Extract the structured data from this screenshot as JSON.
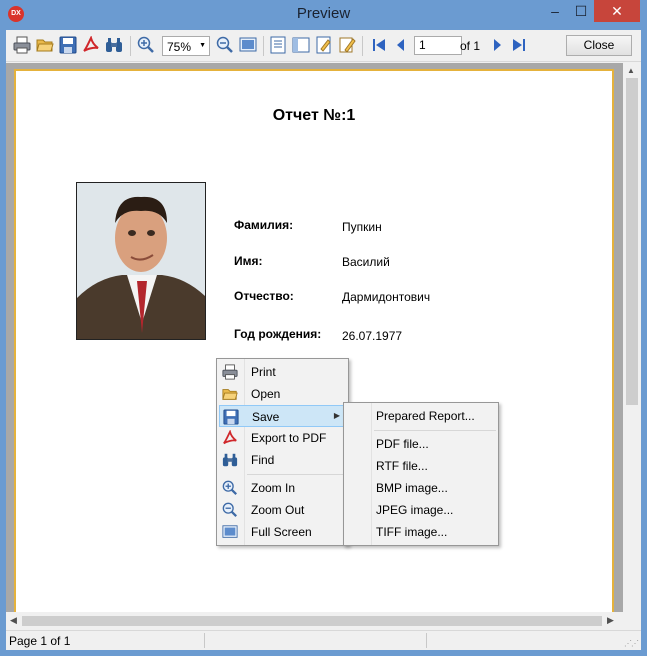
{
  "window": {
    "title": "Preview",
    "app_icon_text": "DX",
    "minimize": "–",
    "maximize": "☐",
    "close": "✕"
  },
  "toolbar": {
    "zoom": "75%",
    "page_current": "1",
    "page_total_text": "of 1",
    "close_label": "Close"
  },
  "report": {
    "title": "Отчет №:1",
    "fields": [
      {
        "label": "Фамилия:",
        "value": "Пупкин"
      },
      {
        "label": "Имя:",
        "value": "Василий"
      },
      {
        "label": "Отчество:",
        "value": "Дармидонтович"
      },
      {
        "label": "Год рождения:",
        "value": "26.07.1977"
      }
    ]
  },
  "context_menu": {
    "items": [
      "Print",
      "Open",
      "Save",
      "Export to PDF",
      "Find",
      "Zoom In",
      "Zoom Out",
      "Full Screen"
    ],
    "highlighted": "Save"
  },
  "save_submenu": {
    "items": [
      "Prepared Report...",
      "PDF file...",
      "RTF file...",
      "BMP image...",
      "JPEG image...",
      "TIFF image..."
    ]
  },
  "statusbar": {
    "text": "Page 1 of 1"
  },
  "colors": {
    "titlebar": "#6b9bd1",
    "close": "#c7453b",
    "page_border": "#e5b23c",
    "highlight": "#cde6f7"
  }
}
